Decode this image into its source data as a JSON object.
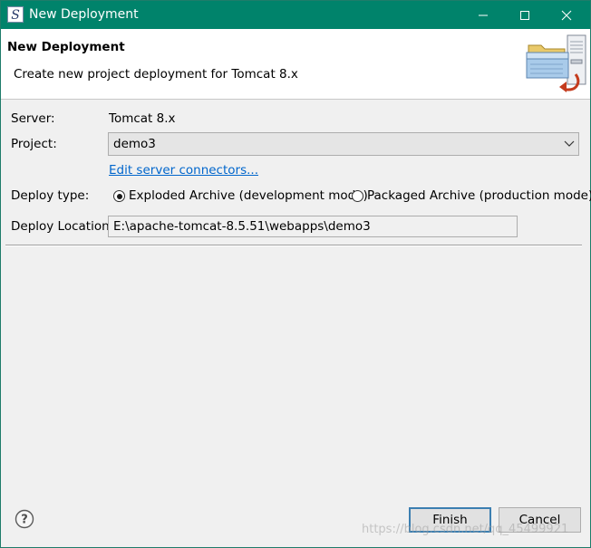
{
  "window": {
    "title": "New Deployment",
    "accent_color": "#00836b"
  },
  "banner": {
    "title": "New Deployment",
    "description": "Create new project deployment for Tomcat  8.x",
    "icon": "deployment-wizard-icon"
  },
  "form": {
    "server_label": "Server:",
    "server_value": "Tomcat  8.x",
    "project_label": "Project:",
    "project_value": "demo3",
    "edit_connectors_link": "Edit server connectors...",
    "deploy_type_label": "Deploy type:",
    "deploy_type_options": [
      {
        "label": "Exploded Archive (development mode)",
        "selected": true
      },
      {
        "label": "Packaged Archive (production mode)",
        "selected": false
      }
    ],
    "deploy_location_label": "Deploy Location:",
    "deploy_location_value": "E:\\apache-tomcat-8.5.51\\webapps\\demo3"
  },
  "footer": {
    "help_icon": "help-icon",
    "finish_label": "Finish",
    "cancel_label": "Cancel"
  },
  "watermark": "https://blog.csdn.net/qq_45499921"
}
